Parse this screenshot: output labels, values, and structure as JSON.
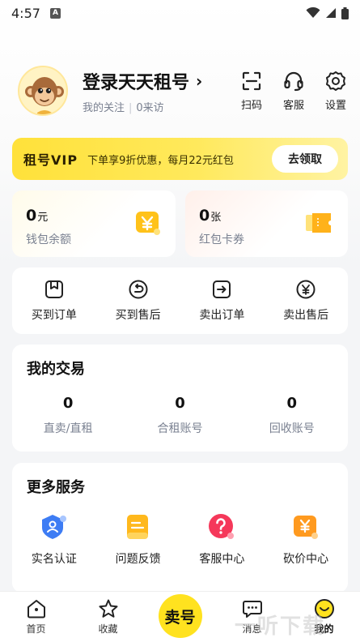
{
  "status_bar": {
    "time": "4:57",
    "notification_badge": "A"
  },
  "profile": {
    "name": "登录天天租号",
    "chevron": "›",
    "follow_label": "我的关注",
    "visits_label": "0来访"
  },
  "toolbar": {
    "scan_label": "扫码",
    "service_label": "客服",
    "settings_label": "设置"
  },
  "vip": {
    "title": "租号VIP",
    "description": "下单享9折优惠，每月22元红包",
    "button_label": "去领取"
  },
  "wallet": {
    "value": "0",
    "unit": "元",
    "label": "钱包余额"
  },
  "coupon": {
    "value": "0",
    "unit": "张",
    "label": "红包卡券"
  },
  "orders": [
    {
      "label": "买到订单",
      "icon": "bookmark-box-icon"
    },
    {
      "label": "买到售后",
      "icon": "return-arrow-icon"
    },
    {
      "label": "卖出订单",
      "icon": "export-arrow-icon"
    },
    {
      "label": "卖出售后",
      "icon": "yen-circle-icon"
    }
  ],
  "trade": {
    "title": "我的交易",
    "stats": [
      {
        "value": "0",
        "label": "直卖/直租"
      },
      {
        "value": "0",
        "label": "合租账号"
      },
      {
        "value": "0",
        "label": "回收账号"
      }
    ]
  },
  "services": {
    "title": "更多服务",
    "items": [
      {
        "label": "实名认证",
        "icon": "id-shield-icon",
        "color": "#3d7cf4"
      },
      {
        "label": "问题反馈",
        "icon": "feedback-doc-icon",
        "color": "#ffb81c"
      },
      {
        "label": "客服中心",
        "icon": "help-circle-icon",
        "color": "#f5385a"
      },
      {
        "label": "砍价中心",
        "icon": "bargain-yen-icon",
        "color": "#ff9a1f"
      }
    ]
  },
  "tabbar": {
    "home_label": "首页",
    "favorites_label": "收藏",
    "sell_label": "卖号",
    "messages_label": "消息",
    "mine_label": "我的"
  },
  "watermark": "一听下载",
  "colors": {
    "accent": "#ffe21f",
    "muted_text": "#7a8191"
  }
}
